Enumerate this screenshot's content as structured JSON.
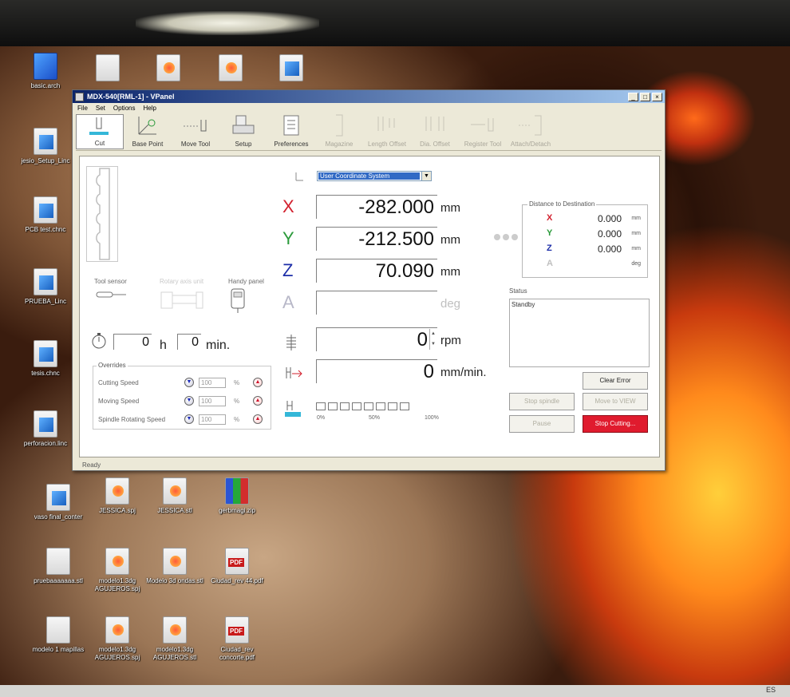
{
  "window": {
    "title": "MDX-540[RML-1] - VPanel",
    "controls": {
      "minimize": "_",
      "maximize": "□",
      "close": "×"
    }
  },
  "menu": [
    "File",
    "Set",
    "Options",
    "Help"
  ],
  "toolbar": [
    {
      "label": "Cut",
      "icon": "cut-icon",
      "state": "selected"
    },
    {
      "label": "Base Point",
      "icon": "base-point-icon",
      "state": "enabled"
    },
    {
      "label": "Move Tool",
      "icon": "move-tool-icon",
      "state": "enabled"
    },
    {
      "label": "Setup",
      "icon": "setup-icon",
      "state": "enabled"
    },
    {
      "label": "Preferences",
      "icon": "preferences-icon",
      "state": "enabled"
    },
    {
      "label": "Magazine",
      "icon": "magazine-icon",
      "state": "disabled"
    },
    {
      "label": "Length Offset",
      "icon": "length-offset-icon",
      "state": "disabled"
    },
    {
      "label": "Dia. Offset",
      "icon": "dia-offset-icon",
      "state": "disabled"
    },
    {
      "label": "Register Tool",
      "icon": "register-tool-icon",
      "state": "disabled"
    },
    {
      "label": "Attach/Detach",
      "icon": "attach-detach-icon",
      "state": "disabled"
    }
  ],
  "coordinate_system": {
    "selected": "User Coordinate System"
  },
  "axes": [
    {
      "axis": "X",
      "value": "-282.000",
      "unit": "mm",
      "color": "#d2202e"
    },
    {
      "axis": "Y",
      "value": "-212.500",
      "unit": "mm",
      "color": "#2a9a3a"
    },
    {
      "axis": "Z",
      "value": "70.090",
      "unit": "mm",
      "color": "#1d2ea8"
    },
    {
      "axis": "A",
      "value": "",
      "unit": "deg",
      "color": "#b8b8c8"
    }
  ],
  "spindle": {
    "value": "0",
    "unit": "rpm"
  },
  "feed": {
    "value": "0",
    "unit": "mm/min."
  },
  "distance": {
    "caption": "Distance to Destination",
    "rows": [
      {
        "axis": "X",
        "value": "0.000",
        "unit": "mm",
        "color": "#d2202e"
      },
      {
        "axis": "Y",
        "value": "0.000",
        "unit": "mm",
        "color": "#2a9a3a"
      },
      {
        "axis": "Z",
        "value": "0.000",
        "unit": "mm",
        "color": "#1d2ea8"
      },
      {
        "axis": "A",
        "value": "",
        "unit": "deg",
        "color": "#c0c0c0"
      }
    ]
  },
  "status": {
    "caption": "Status",
    "text": "Standby"
  },
  "buttons": {
    "clear_error": "Clear Error",
    "stop_spindle": "Stop spindle",
    "move_view": "Move to VIEW",
    "pause": "Pause",
    "stop_cutting": "Stop Cutting..."
  },
  "sensors": {
    "tool_sensor": "Tool sensor",
    "rotary_axis_unit": "Rotary axis unit",
    "handy_panel": "Handy panel"
  },
  "timer": {
    "hours": "0",
    "hours_unit": "h",
    "minutes": "0",
    "minutes_unit": "min."
  },
  "overrides": {
    "caption": "Overrides",
    "rows": [
      {
        "name": "Cutting Speed",
        "value": "100",
        "unit": "%"
      },
      {
        "name": "Moving Speed",
        "value": "100",
        "unit": "%"
      },
      {
        "name": "Spindle Rotating Speed",
        "value": "100",
        "unit": "%"
      }
    ]
  },
  "progress": {
    "fraction": 0,
    "segments": 8,
    "labels": [
      "0%",
      "50%",
      "100%"
    ]
  },
  "statusbar": {
    "text": "Ready"
  },
  "desktop_icons": [
    {
      "label": "basic.arch",
      "type": "cube"
    },
    {
      "label": "",
      "type": "doc"
    },
    {
      "label": "",
      "type": "stl"
    },
    {
      "label": "",
      "type": "stl"
    },
    {
      "label": "",
      "type": "setup"
    },
    {
      "label": "jesio_Setup_Linc",
      "type": "setup"
    },
    {
      "label": "PCB test.chnc",
      "type": "setup"
    },
    {
      "label": "PRUEBA_Linc",
      "type": "setup"
    },
    {
      "label": "tesis.chnc",
      "type": "setup"
    },
    {
      "label": "perforacion.linc",
      "type": "setup"
    },
    {
      "label": "vaso final_conter",
      "type": "setup"
    },
    {
      "label": "JESSICA.spj",
      "type": "stl"
    },
    {
      "label": "JESSICA.stl",
      "type": "stl"
    },
    {
      "label": "gerbmagi.zip",
      "type": "zip"
    },
    {
      "label": "pruebaaaaaaa.stl",
      "type": "doc"
    },
    {
      "label": "modelo1.3dg AGUJEROS.spj",
      "type": "stl"
    },
    {
      "label": "Modelo 3d ondas.stl",
      "type": "stl"
    },
    {
      "label": "Ciudad_rev 44.pdf",
      "type": "pdf"
    },
    {
      "label": "modelo 1 mapillas",
      "type": "doc"
    },
    {
      "label": "modelo1.3dg AGUJEROS.spj",
      "type": "stl"
    },
    {
      "label": "modelo1.3dg AGUJEROS.stl",
      "type": "stl"
    },
    {
      "label": "Ciudad_rev concorte.pdf",
      "type": "pdf"
    }
  ],
  "tray": {
    "language": "ES"
  }
}
